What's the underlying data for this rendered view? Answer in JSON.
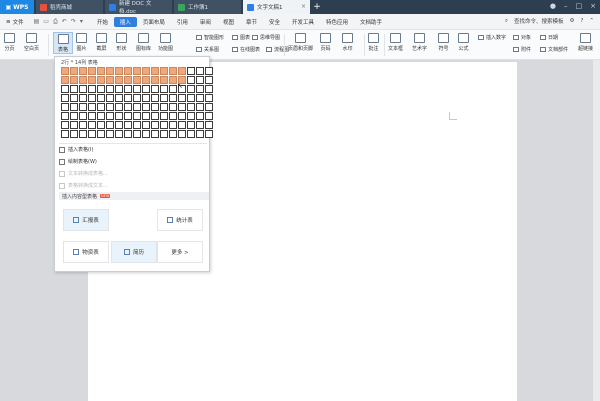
{
  "tabbar": {
    "wps_label": "WPS",
    "tabs": [
      {
        "label": "稻壳商城",
        "color": "#e8503a"
      },
      {
        "label": "新建 DOC 文档.doc",
        "color": "#2f7fe0"
      },
      {
        "label": "工作簿1",
        "color": "#3aa55b"
      },
      {
        "label": "文字文稿1",
        "color": "#2f7fe0"
      }
    ],
    "new_tab": "+"
  },
  "menubar": {
    "file_label": "文件",
    "items": [
      "开始",
      "插入",
      "页面布局",
      "引用",
      "审阅",
      "视图",
      "章节",
      "安全",
      "开发工具",
      "特色应用",
      "文档助手"
    ],
    "active_index": 1,
    "search_label": "查找命令、搜索模板"
  },
  "ribbon": {
    "big": [
      "分页",
      "空白页",
      "表格",
      "图片",
      "截屏",
      "形状",
      "图标库",
      "功能图",
      "页眉和页脚",
      "页码",
      "水印",
      "批注",
      "文本框",
      "艺术字",
      "符号",
      "公式"
    ],
    "small": [
      "智能图形",
      "图表",
      "思维导图",
      "关系图",
      "在线图表",
      "流程图",
      "插入数字",
      "对象",
      "日期",
      "附件",
      "文档部件",
      "超链接"
    ]
  },
  "table_dropdown": {
    "header": "2行 * 14列 表格",
    "grid_rows": 8,
    "grid_cols": 17,
    "selected_rows": 2,
    "selected_cols": 14,
    "items": [
      {
        "label": "插入表格(I)",
        "enabled": true
      },
      {
        "label": "绘制表格(W)",
        "enabled": true
      },
      {
        "label": "文本转换成表格...",
        "enabled": false
      },
      {
        "label": "表格转换成文本...",
        "enabled": false
      }
    ],
    "content_section": "插入内容型表格",
    "new_badge": "NEW",
    "cards": [
      "汇报表",
      "统计表",
      "物资表",
      "简历",
      "更多 >"
    ]
  }
}
